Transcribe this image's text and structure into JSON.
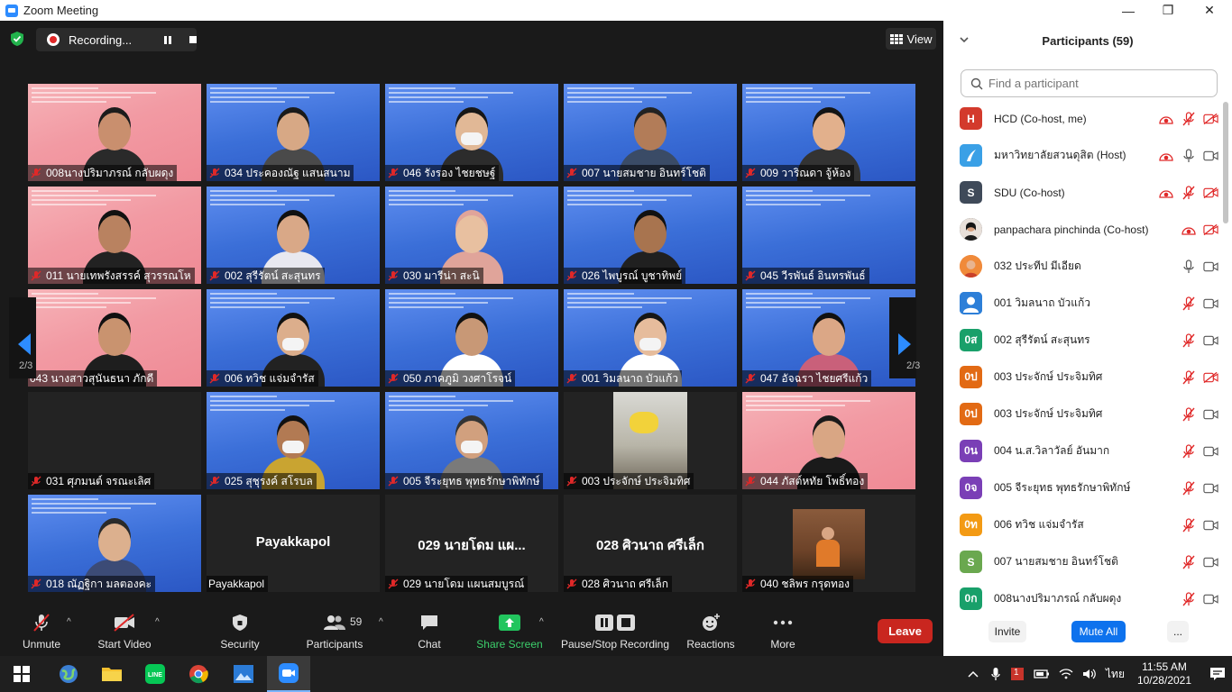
{
  "window": {
    "title": "Zoom Meeting",
    "minimize_glyph": "—",
    "restore_glyph": "❐",
    "close_glyph": "✕"
  },
  "meeting": {
    "recording_label": "Recording...",
    "view_label": "View",
    "page_indicator": "2/3",
    "tiles": [
      {
        "name": "008นางปริมาภรณ์ กลับผดุง",
        "bg": "pink",
        "muted": true,
        "skin": "#c98f6e",
        "cloth": "#2a2a2a",
        "hair": "#1c1c1c"
      },
      {
        "name": "034 ประคองณัฐ แสนสนาม",
        "bg": "blue",
        "muted": true,
        "skin": "#d7a885",
        "cloth": "#4a4a4a",
        "hair": "#1a1a1a"
      },
      {
        "name": "046 รังรอง ไชยชษฐ์",
        "bg": "blue",
        "muted": true,
        "skin": "#e1b896",
        "cloth": "#2c2c2c",
        "hair": "#171717",
        "mask": true
      },
      {
        "name": "007 นายสมชาย อินทร์โชติ",
        "bg": "blue",
        "muted": true,
        "skin": "#b27c58",
        "cloth": "#3a4b66",
        "hair": "#222"
      },
      {
        "name": "009 วาริณดา จู้ห้อง",
        "bg": "blue",
        "muted": true,
        "skin": "#e2b08c",
        "cloth": "#333",
        "hair": "#141414"
      },
      {
        "name": "011 นายเทพรังสรรค์ สุวรรณโห",
        "bg": "pink",
        "muted": true,
        "skin": "#b98260",
        "cloth": "#222",
        "hair": "#111"
      },
      {
        "name": "002 สุรีรัตน์ สะสุนทร",
        "bg": "blue",
        "muted": true,
        "skin": "#d9a887",
        "cloth": "#e8e8f0",
        "hair": "#111"
      },
      {
        "name": "030 มารีน่า สะนิ",
        "bg": "blue",
        "muted": true,
        "skin": "#e8c0a0",
        "cloth": "#e0a49a",
        "hair": "#e0a49a"
      },
      {
        "name": "026 ไพบูรณ์ บูชาทิพย์",
        "bg": "blue",
        "muted": true,
        "skin": "#a8744f",
        "cloth": "#202020",
        "hair": "#111"
      },
      {
        "name": "045 วีรพันธ์ อินทรพันธ์",
        "bg": "blue",
        "muted": true,
        "skin": "#d8a582",
        "cloth": "#3a3a3a",
        "hair": "#222",
        "empty": true
      },
      {
        "name": "043 นางสาวสุนันธนา ภักดี",
        "bg": "pink",
        "muted": false,
        "skin": "#c9936f",
        "cloth": "#1e1e1e",
        "hair": "#111"
      },
      {
        "name": "006 ทวิช แจ่มจำรัส",
        "bg": "blue",
        "muted": true,
        "skin": "#dcae8c",
        "cloth": "#222",
        "hair": "#111",
        "mask": true
      },
      {
        "name": "050 ภาคภูมิ วงศาโรจน์",
        "bg": "blue",
        "muted": true,
        "skin": "#c89876",
        "cloth": "#ffffff",
        "hair": "#111"
      },
      {
        "name": "001 วิมลนาถ บัวแก้ว",
        "bg": "blue",
        "muted": true,
        "skin": "#e6bc9c",
        "cloth": "#ffffff",
        "hair": "#161616",
        "mask": true
      },
      {
        "name": "047 อัจฉรา ไชยศรีแก้ว",
        "bg": "blue",
        "muted": true,
        "skin": "#dba786",
        "cloth": "#c9607a",
        "hair": "#111"
      },
      {
        "name": "031 ศุภมนต์ จรณะเลิศ",
        "bg": "dark",
        "muted": true,
        "empty": true
      },
      {
        "name": "025 สุชุรงค์ สโรบล",
        "bg": "blue",
        "muted": true,
        "skin": "#b27a53",
        "cloth": "#c9a431",
        "hair": "#111",
        "mask": true
      },
      {
        "name": "005 จีระยุทธ พุทธรักษาพิทักษ์",
        "bg": "blue",
        "muted": true,
        "skin": "#d1a07e",
        "cloth": "#7a7a7a",
        "hair": "#333",
        "mask": true
      },
      {
        "name": "003 ประจักษ์ ประจิมทิศ",
        "bg": "dark",
        "muted": true,
        "photo": true
      },
      {
        "name": "044 ภัสต์หทัย โพธิ์ทอง",
        "bg": "pink",
        "muted": true,
        "skin": "#d9a684",
        "cloth": "#1a1a1a",
        "hair": "#1a1a1a"
      },
      {
        "name": "018 ณัฏฐิกา มลตองคะ",
        "bg": "blue",
        "muted": true,
        "skin": "#dcb08e",
        "cloth": "#3c4b76",
        "hair": "#2a2a2a"
      },
      {
        "name": "Payakkapol",
        "bg": "dark",
        "muted": false,
        "center": "Payakkapol"
      },
      {
        "name": "029 นายโดม แผนสมบูรณ์",
        "bg": "dark",
        "muted": true,
        "center": "029 นายโดม แผ..."
      },
      {
        "name": "028 ศิวนาถ ศรีเล็ก",
        "bg": "dark",
        "muted": true,
        "center": "028 ศิวนาถ ศรีเล็ก"
      },
      {
        "name": "040 ชลิพร กรุดทอง",
        "bg": "dark",
        "muted": true,
        "photo2": true
      }
    ]
  },
  "toolbar": {
    "unmute": "Unmute",
    "start_video": "Start Video",
    "security": "Security",
    "participants": "Participants",
    "participants_count": "59",
    "chat": "Chat",
    "share_screen": "Share Screen",
    "pause_stop_recording": "Pause/Stop Recording",
    "reactions": "Reactions",
    "more": "More",
    "leave": "Leave"
  },
  "panel": {
    "title": "Participants (59)",
    "search_placeholder": "Find a participant",
    "participants": [
      {
        "initial": "H",
        "color": "#d33a2c",
        "name": "HCD (Co-host, me)",
        "rec": true,
        "mic": "muted",
        "video": "off"
      },
      {
        "initial": "",
        "color": "#3aa0e6",
        "name": "มหาวิทยาลัยสวนดุสิต (Host)",
        "rec": true,
        "mic": "on",
        "video": "on",
        "logo": true
      },
      {
        "initial": "S",
        "color": "#3f4a59",
        "name": "SDU (Co-host)",
        "rec": true,
        "mic": "muted",
        "video": "off"
      },
      {
        "initial": "",
        "color": "#2a2a2a",
        "name": "panpachara pinchinda (Co-host)",
        "rec": true,
        "mic": "none",
        "video": "off",
        "photo": true
      },
      {
        "initial": "",
        "color": "#f08a3a",
        "name": "032 ประทีป มีเอียด",
        "rec": false,
        "mic": "on",
        "video": "on",
        "photo2": true
      },
      {
        "initial": "",
        "color": "#2d7fd8",
        "name": "001 วิมลนาถ บัวแก้ว",
        "rec": false,
        "mic": "muted",
        "video": "on",
        "user": true
      },
      {
        "initial": "0ส",
        "color": "#19a06a",
        "name": "002 สุรีรัตน์ สะสุนทร",
        "rec": false,
        "mic": "muted",
        "video": "on"
      },
      {
        "initial": "0ป",
        "color": "#e26a14",
        "name": "003 ประจักษ์ ประจิมทิศ",
        "rec": false,
        "mic": "muted",
        "video": "off"
      },
      {
        "initial": "0ป",
        "color": "#e26a14",
        "name": "003 ประจักษ์ ประจิมทิศ",
        "rec": false,
        "mic": "muted",
        "video": "on"
      },
      {
        "initial": "0น",
        "color": "#7a3fb6",
        "name": "004 น.ส.วิลาวัลย์ อันมาก",
        "rec": false,
        "mic": "muted",
        "video": "on"
      },
      {
        "initial": "0จ",
        "color": "#7a3fb6",
        "name": "005 จีระยุทธ พุทธรักษาพิทักษ์",
        "rec": false,
        "mic": "muted",
        "video": "on"
      },
      {
        "initial": "0ท",
        "color": "#f39a14",
        "name": "006 ทวิช แจ่มจำรัส",
        "rec": false,
        "mic": "muted",
        "video": "on"
      },
      {
        "initial": "S",
        "color": "#6aa84f",
        "name": "007 นายสมชาย อินทร์โชติ",
        "rec": false,
        "mic": "muted",
        "video": "on"
      },
      {
        "initial": "0ก",
        "color": "#19a06a",
        "name": "008นางปริมาภรณ์ กลับผดุง",
        "rec": false,
        "mic": "muted",
        "video": "on"
      }
    ],
    "invite": "Invite",
    "mute_all": "Mute All",
    "more_dots": "..."
  },
  "taskbar": {
    "time": "11:55 AM",
    "date": "10/28/2021",
    "lang": "ไทย",
    "notif_badge": "1",
    "line_label": "LINE"
  },
  "colors": {
    "accent": "#2d8cff",
    "leave": "#c9261f",
    "muted_red": "#e02828",
    "share_green": "#22c55e"
  }
}
